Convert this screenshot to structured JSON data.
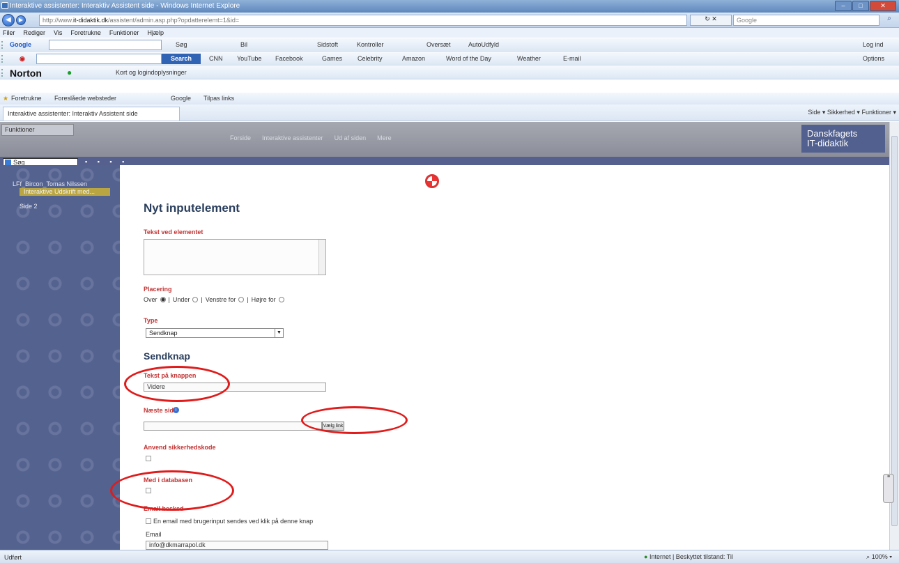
{
  "window": {
    "title": "Interaktive assistenter: Interaktiv Assistent side - Windows Internet Explorer"
  },
  "addressbar": {
    "url_prefix": "http://www.",
    "url_domain": "it-didaktik.dk",
    "url_rest": "/assistent/admin.asp.php?opdatterelemt=1&id=",
    "search_placeholder": "Google",
    "refresh": "↻",
    "stop": "✕"
  },
  "menubar": [
    "Filer",
    "Rediger",
    "Vis",
    "Foretrukne",
    "Funktioner",
    "Hjælp"
  ],
  "google_toolbar": {
    "label": "Google",
    "items": [
      "Søg",
      "Bil",
      "Sidstoft",
      "Kontroller",
      "Oversæt",
      "AutoUdfyld"
    ],
    "right": "Log ind"
  },
  "search_toolbar": {
    "button": "Search",
    "links": [
      "CNN",
      "YouTube",
      "Facebook",
      "Games",
      "Celebrity",
      "Amazon",
      "Word of the Day",
      "Weather",
      "E-mail"
    ],
    "right": "Options"
  },
  "norton_toolbar": {
    "brand": "Norton",
    "item": "Kort og logindoplysninger"
  },
  "favorites_bar": {
    "favorites": "Foretrukne",
    "suggested": "Foreslåede websteder",
    "google": "Google",
    "tips": "Tilpas links"
  },
  "tab": {
    "label": "Interaktive assistenter: Interaktiv Assistent side"
  },
  "command_bar": "Side ▾   Sikkerhed ▾   Funktioner ▾",
  "app": {
    "sidebar_tab": "Funktioner",
    "topnav": [
      "Forside",
      "Interaktive assistenter",
      "Ud af siden",
      "Mere"
    ],
    "brand_line1": "Danskfagets",
    "brand_line2": "IT-didaktik",
    "sidebar_search": "Søg",
    "tree": {
      "root": "LFf_Bircon_Tomas Nilssen",
      "selected": "Interaktive Udskrift med...",
      "child2": "Side 2"
    }
  },
  "form": {
    "heading": "Nyt inputelement",
    "text_label": "Tekst ved elementet",
    "placement_label": "Placering",
    "placement_options": {
      "over": "Over",
      "under": "Under",
      "left": "Venstre for",
      "right": "Højre for"
    },
    "type_label": "Type",
    "type_value": "Sendknap",
    "section_heading": "Sendknap",
    "button_text_label": "Tekst på knappen",
    "button_text_value": "Videre",
    "next_page_label": "Næste side",
    "choose_button": "Vælg link",
    "safe_mode_label": "Anvend sikkerhedskode",
    "database_label": "Med i databasen",
    "email_section_label": "Email besked",
    "email_checkbox_label": "En email med brugerinput sendes ved klik på denne knap",
    "email_field_label": "Email",
    "email_value": "info@dkmarrapol.dk"
  },
  "statusbar": {
    "left": "Udført",
    "zone": "Internet | Beskyttet tilstand: Til",
    "zoom": "100%"
  }
}
